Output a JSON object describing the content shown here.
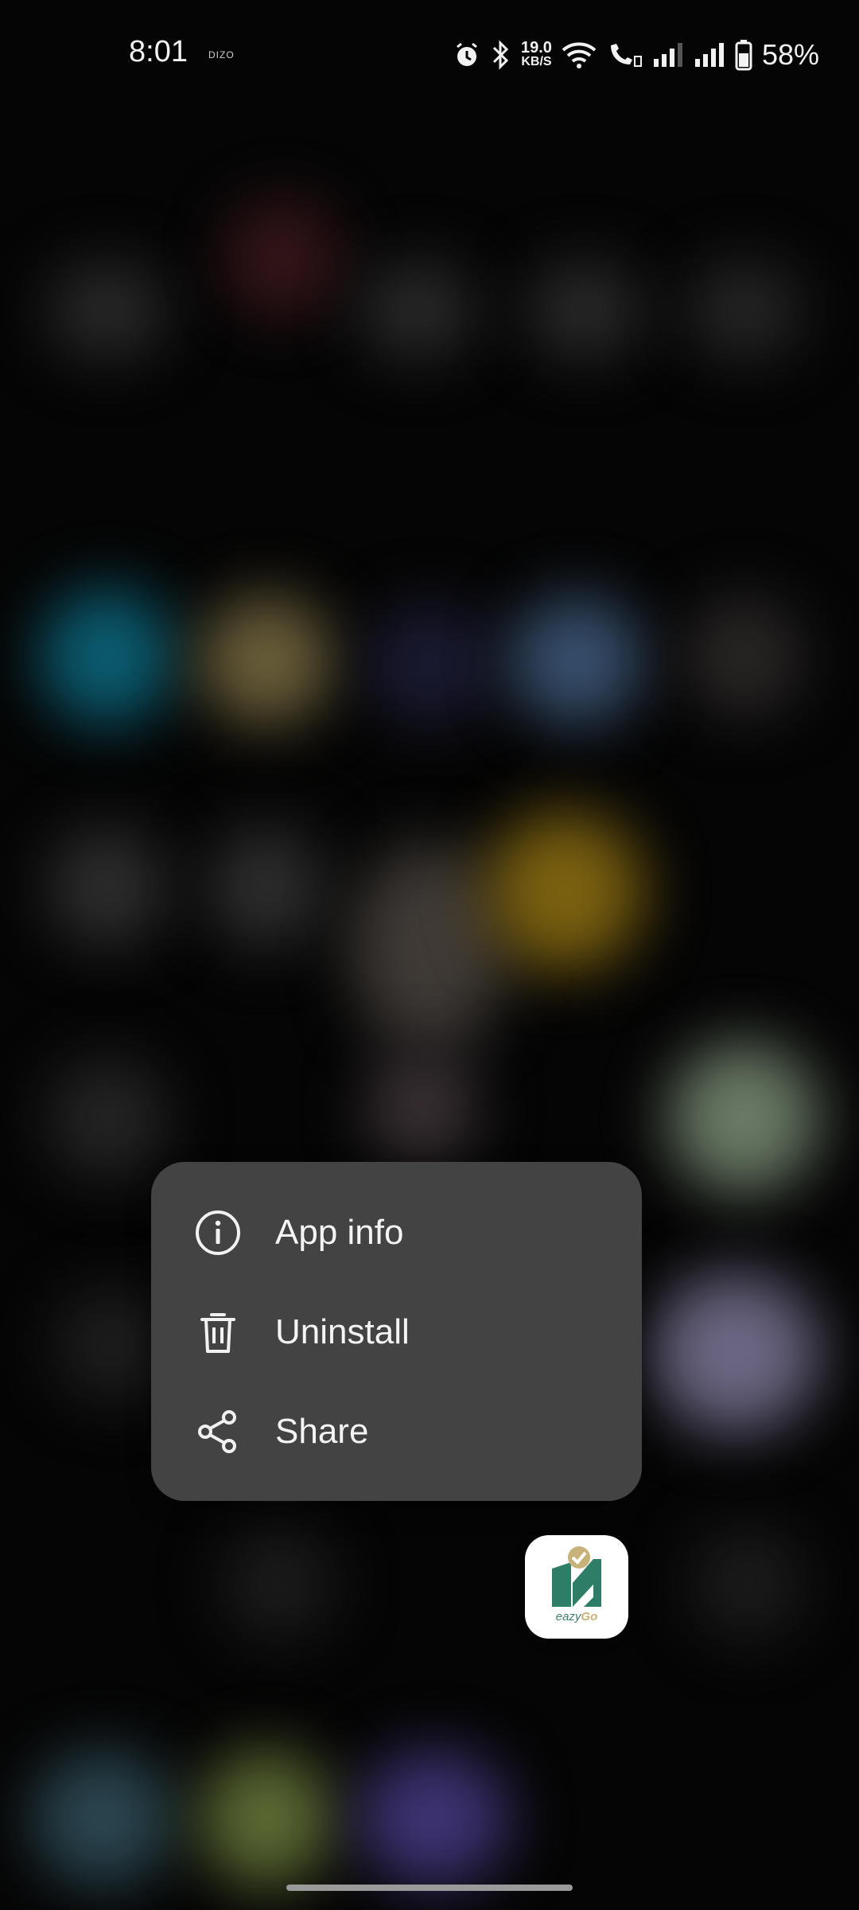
{
  "status_bar": {
    "time": "8:01",
    "carrier": "DIZO",
    "net_speed_value": "19.0",
    "net_speed_unit": "KB/S",
    "battery_percent": "58%",
    "icons": [
      "alarm-icon",
      "bluetooth-icon",
      "wifi-icon",
      "wifi-calling-icon",
      "signal-sim1-icon",
      "signal-sim2-icon",
      "battery-icon"
    ]
  },
  "context_menu": {
    "items": [
      {
        "label": "App info",
        "icon": "info-icon"
      },
      {
        "label": "Uninstall",
        "icon": "trash-icon"
      },
      {
        "label": "Share",
        "icon": "share-icon"
      }
    ]
  },
  "app": {
    "brand_prefix": "eazy",
    "brand_suffix": "Go",
    "colors": {
      "primary": "#2e7d66",
      "accent": "#c7b27a"
    }
  },
  "colors": {
    "menu_background": "#434343",
    "screen_background": "#050505"
  }
}
